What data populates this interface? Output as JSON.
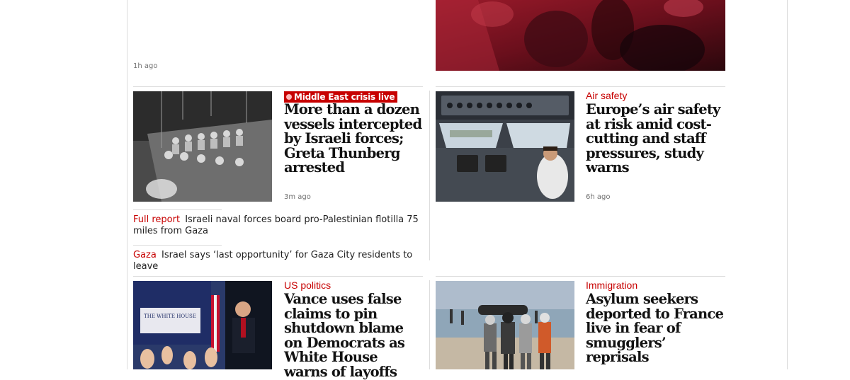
{
  "top": {
    "left_time": "1h ago"
  },
  "card_gaza": {
    "badge": "Middle East crisis live",
    "headline": "More than a dozen vessels intercepted by Israeli forces; Greta Thunberg arrested",
    "time": "3m ago",
    "sublinks": [
      {
        "tag": "Full report",
        "text": "Israeli naval forces board pro-Palestinian flotilla 75 miles from Gaza"
      },
      {
        "tag": "Gaza",
        "text": "Israel says ‘last opportunity’ for Gaza City residents to leave"
      }
    ],
    "accent": "#c70000"
  },
  "card_air": {
    "kicker": "Air safety",
    "headline": "Europe’s air safety at risk amid cost-cutting and staff pressures, study warns",
    "time": "6h ago"
  },
  "card_vance": {
    "kicker": "US politics",
    "headline": "Vance uses false claims to pin shutdown blame on Democrats as White House warns of layoffs",
    "image_text": "THE WHITE HOUSE"
  },
  "card_asylum": {
    "kicker": "Immigration",
    "headline": "Asylum seekers deported to France live in fear of smugglers’ reprisals"
  }
}
